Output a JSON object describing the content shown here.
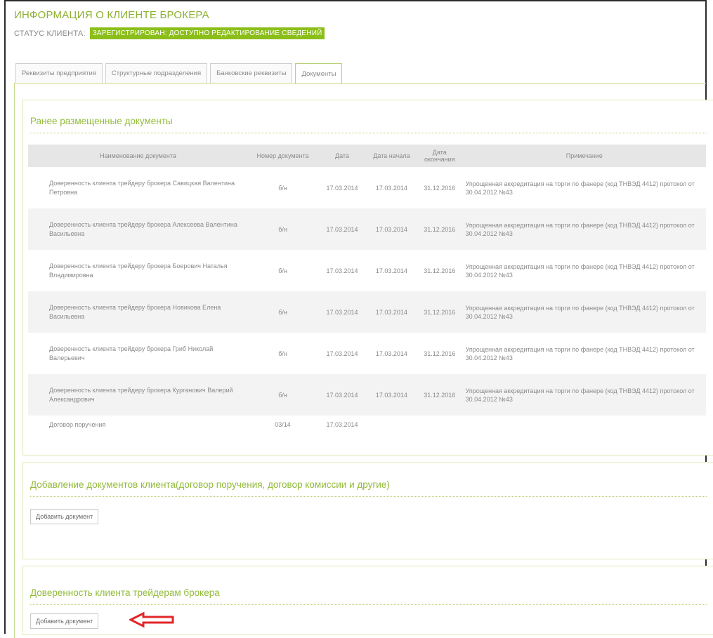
{
  "header": {
    "title": "ИНФОРМАЦИЯ О КЛИЕНТЕ БРОКЕРА",
    "status_label": "СТАТУС КЛИЕНТА:",
    "status_value": "ЗАРЕГИСТРИРОВАН: ДОСТУПНО РЕДАКТИРОВАНИЕ СВЕДЕНИЙ"
  },
  "tabs": [
    {
      "label": "Реквизиты предприятия"
    },
    {
      "label": "Структурные подразделения"
    },
    {
      "label": "Банковские реквизиты"
    },
    {
      "label": "Документы"
    }
  ],
  "documents_section": {
    "title": "Ранее размещенные документы",
    "columns": [
      "Наименование документа",
      "Номер документа",
      "Дата",
      "Дата начала",
      "Дата окончания",
      "Примечание"
    ],
    "rows": [
      {
        "name": "Доверенность клиента трейдеру брокера Савицкая Валентина Петровна",
        "number": "б/н",
        "date": "17.03.2014",
        "start": "17.03.2014",
        "end": "31.12.2016",
        "note": "Упрощенная аккредитация на торги по фанере (код ТНВЭД 4412) протокол от 30.04.2012 №43"
      },
      {
        "name": "Доверенность клиента трейдеру брокера Алексеева Валентина Васильевна",
        "number": "б/н",
        "date": "17.03.2014",
        "start": "17.03.2014",
        "end": "31.12.2016",
        "note": "Упрощенная аккредитация на торги по фанере (код ТНВЭД 4412) протокол от 30.04.2012 №43"
      },
      {
        "name": "Доверенность клиента трейдеру брокера Боерович Наталья Владимировна",
        "number": "б/н",
        "date": "17.03.2014",
        "start": "17.03.2014",
        "end": "31.12.2016",
        "note": "Упрощенная аккредитация на торги по фанере (код ТНВЭД 4412) протокол от 30.04.2012 №43"
      },
      {
        "name": "Доверенность клиента трейдеру брокера Новикова Елена Васильевна",
        "number": "б/н",
        "date": "17.03.2014",
        "start": "17.03.2014",
        "end": "31.12.2016",
        "note": "Упрощенная аккредитация на торги по фанере (код ТНВЭД 4412) протокол от 30.04.2012 №43"
      },
      {
        "name": "Доверенность клиента трейдеру брокера Гриб Николай Валерьевич",
        "number": "б/н",
        "date": "17.03.2014",
        "start": "17.03.2014",
        "end": "31.12.2016",
        "note": "Упрощенная аккредитация на торги по фанере (код ТНВЭД 4412) протокол от 30.04.2012 №43"
      },
      {
        "name": "Доверенность клиента трейдеру брокера Курганович Валерий Александрович",
        "number": "б/н",
        "date": "17.03.2014",
        "start": "17.03.2014",
        "end": "31.12.2016",
        "note": "Упрощенная аккредитация на торги по фанере (код ТНВЭД 4412) протокол от 30.04.2012 №43"
      },
      {
        "name": "Договор поручения",
        "number": "03/14",
        "date": "17.03.2014",
        "start": "",
        "end": "",
        "note": ""
      }
    ]
  },
  "add_documents_section": {
    "title": "Добавление документов клиента(договор поручения, договор комиссии и другие)",
    "button_label": "Добавить документ"
  },
  "power_of_attorney_section": {
    "title": "Доверенность клиента трейдерам брокера",
    "button_label": "Добавить документ"
  },
  "colors": {
    "accent": "#8cbe1a",
    "title_green": "#93bb3a",
    "arrow_red": "#e0262a"
  },
  "icons": {
    "annotation_arrow": "left-arrow-icon"
  }
}
